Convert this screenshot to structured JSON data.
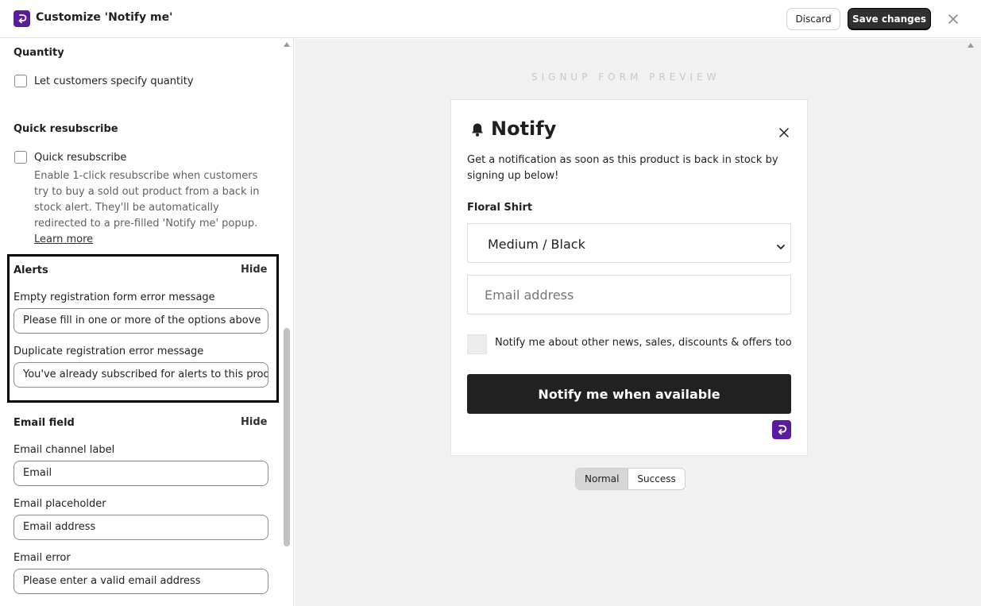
{
  "header": {
    "title": "Customize 'Notify me'",
    "discard_label": "Discard",
    "save_label": "Save changes"
  },
  "settings": {
    "quantity": {
      "title": "Quantity",
      "checkbox_label": "Let customers specify quantity",
      "checked": false
    },
    "quick_resubscribe": {
      "title": "Quick resubscribe",
      "checkbox_label": "Quick resubscribe",
      "checked": false,
      "help_text": "Enable 1-click resubscribe when customers try to buy a sold out product from a back in stock alert. They'll be automatically redirected to a pre-filled 'Notify me' popup.",
      "learn_more": "Learn more"
    },
    "alerts": {
      "title": "Alerts",
      "hide_label": "Hide",
      "empty_label": "Empty registration form error message",
      "empty_value": "Please fill in one or more of the options above",
      "duplicate_label": "Duplicate registration error message",
      "duplicate_value": "You've already subscribed for alerts to this product"
    },
    "email_field": {
      "title": "Email field",
      "hide_label": "Hide",
      "channel_label": "Email channel label",
      "channel_value": "Email",
      "placeholder_label": "Email placeholder",
      "placeholder_value": "Email address",
      "error_label": "Email error",
      "error_value": "Please enter a valid email address"
    }
  },
  "preview": {
    "label": "SIGNUP FORM PREVIEW",
    "form": {
      "title": "Notify",
      "description": "Get a notification as soon as this product is back in stock by signing up below!",
      "product_name": "Floral Shirt",
      "variant": "Medium / Black",
      "email_placeholder": "Email address",
      "marketing_label": "Notify me about other news, sales, discounts & offers too",
      "button_label": "Notify me when available"
    },
    "states": [
      "Normal",
      "Success"
    ],
    "active_state": "Normal"
  },
  "colors": {
    "brand": "#5b1aa3",
    "primary_button": "#303030",
    "form_button": "#212121",
    "preview_bg": "#f1f1f1"
  },
  "icons": {
    "app_logo": "arrow-return-icon",
    "close": "close-icon",
    "bell": "bell-icon",
    "select": "chevron-down-icon"
  }
}
